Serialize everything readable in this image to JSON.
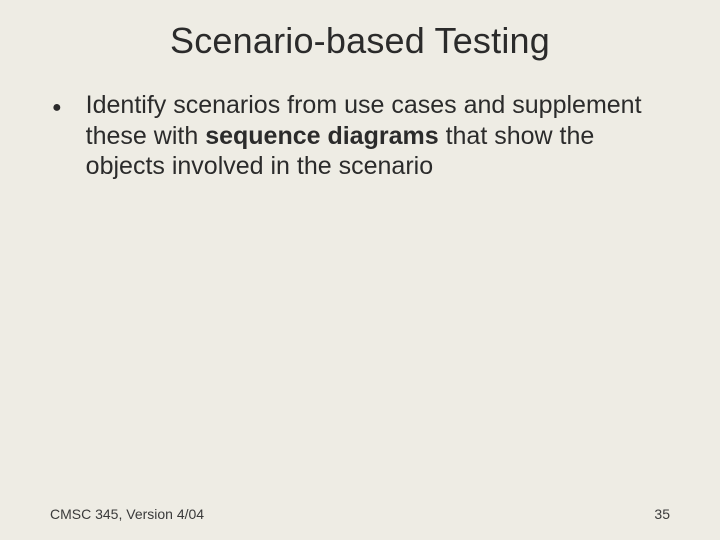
{
  "slide": {
    "title": "Scenario-based Testing",
    "bullet": {
      "pre": "Identify scenarios from use cases and supplement these with ",
      "bold": "sequence diagrams",
      "post": " that show the objects involved in the scenario"
    },
    "footer": {
      "left": "CMSC 345, Version 4/04",
      "pageNumber": "35"
    }
  }
}
